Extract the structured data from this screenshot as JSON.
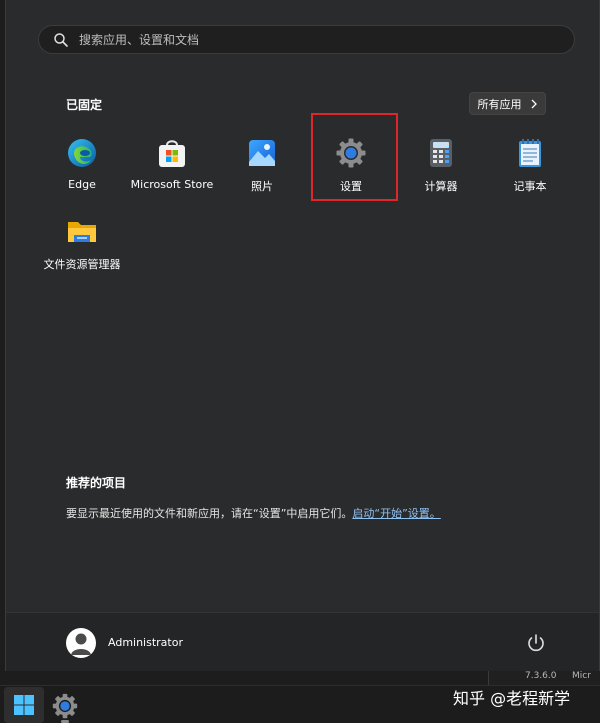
{
  "search": {
    "placeholder": "搜索应用、设置和文档"
  },
  "pinned": {
    "title": "已固定",
    "all_apps_label": "所有应用",
    "apps": [
      {
        "label": "Edge",
        "icon": "edge-icon"
      },
      {
        "label": "Microsoft Store",
        "icon": "store-icon"
      },
      {
        "label": "照片",
        "icon": "photos-icon"
      },
      {
        "label": "设置",
        "icon": "settings-gear-icon"
      },
      {
        "label": "计算器",
        "icon": "calculator-icon"
      },
      {
        "label": "记事本",
        "icon": "notepad-icon"
      },
      {
        "label": "文件资源管理器",
        "icon": "folder-icon"
      }
    ]
  },
  "recommended": {
    "title": "推荐的项目",
    "text": "要显示最近使用的文件和新应用，请在“设置”中启用它们。",
    "link": "启动“开始”设置。"
  },
  "user": {
    "name": "Administrator"
  },
  "background_window": {
    "version": "7.3.6.0",
    "partial": "Micr"
  },
  "watermark": "知乎 @老程新学",
  "colors": {
    "highlight": "#e0262b",
    "link": "#8fc3f5",
    "panel": "#2a2b2c"
  }
}
